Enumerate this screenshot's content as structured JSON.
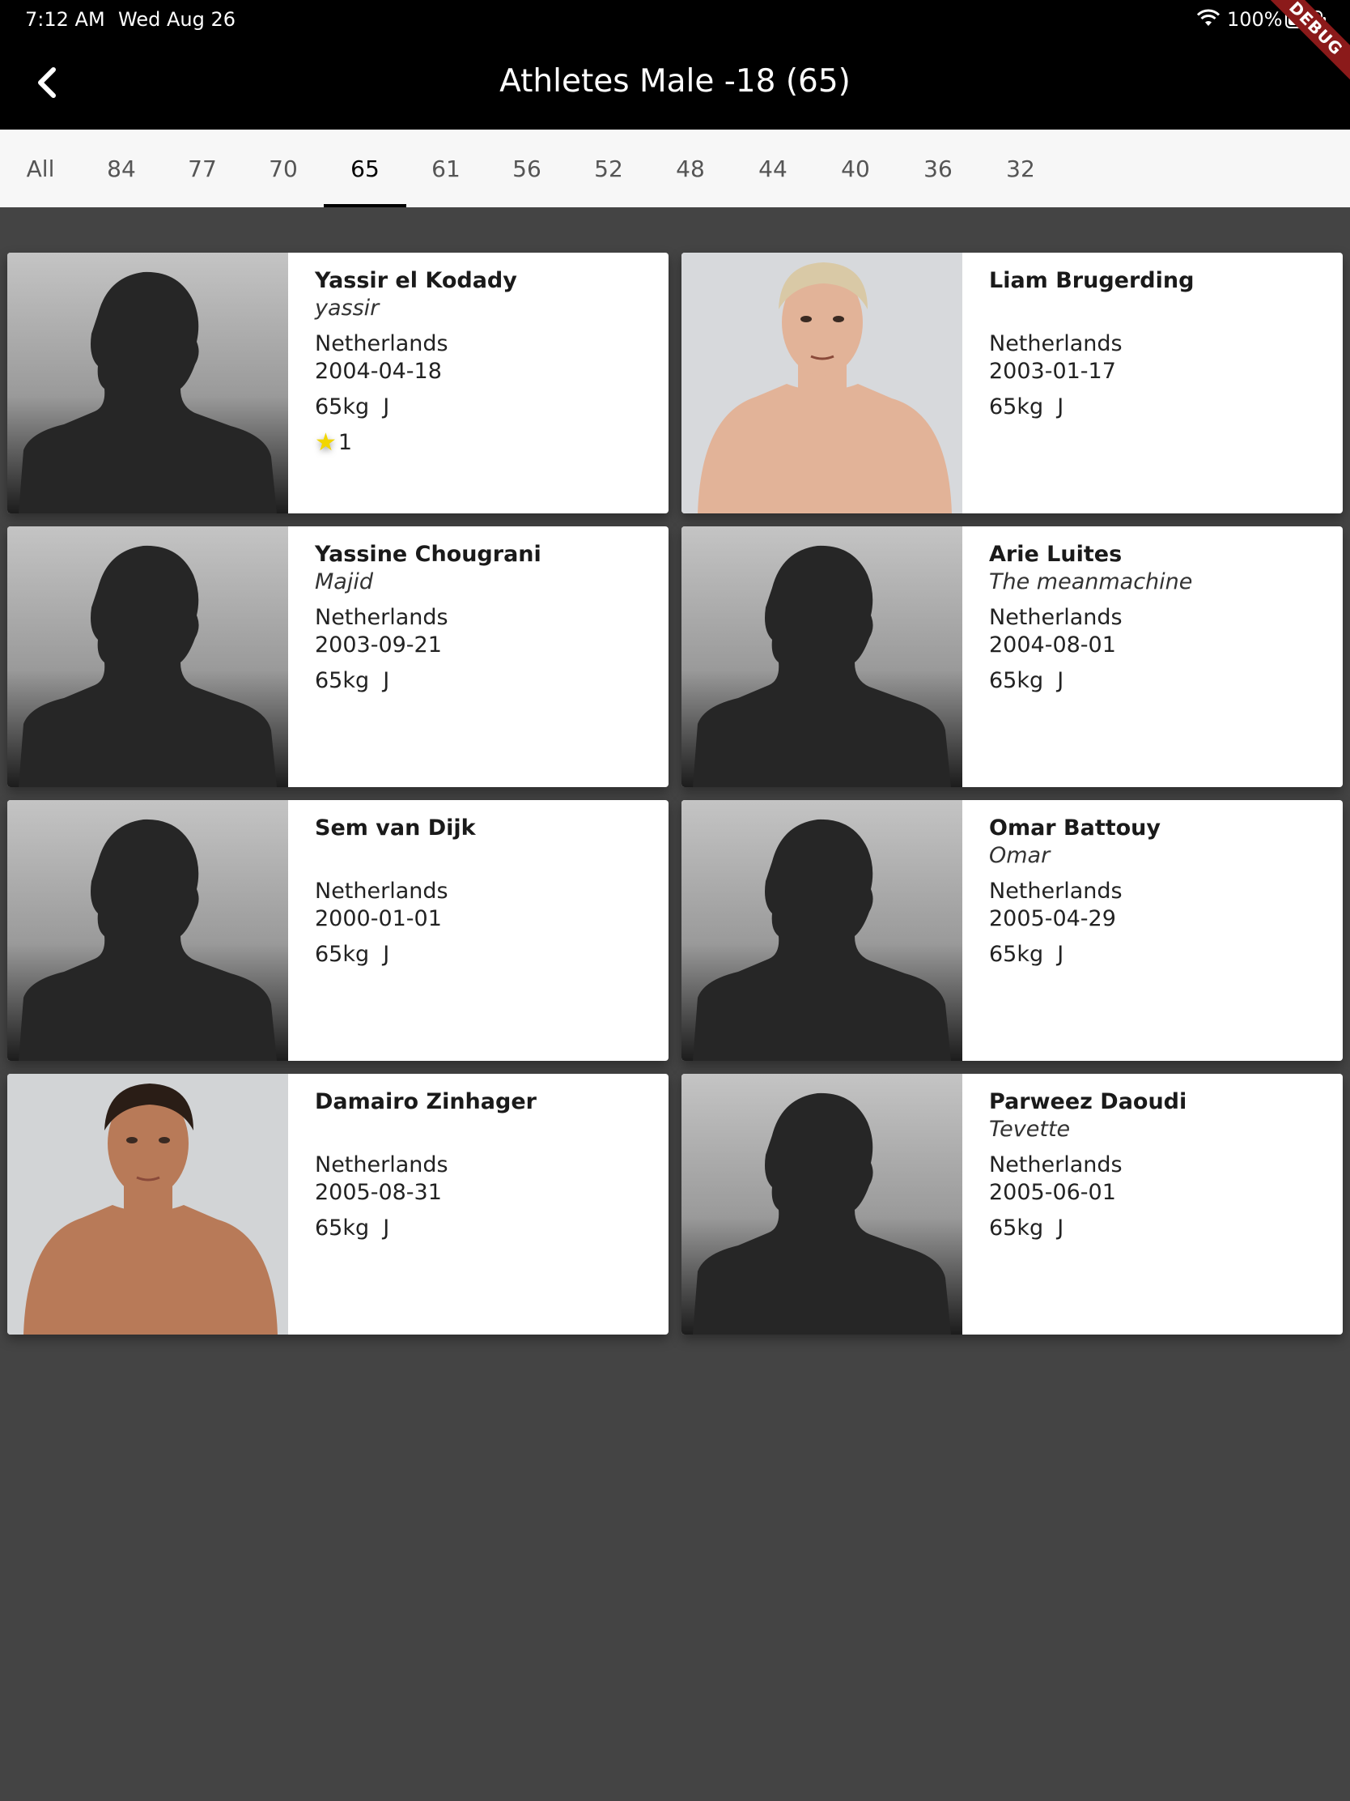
{
  "status": {
    "time": "7:12 AM",
    "date": "Wed Aug 26",
    "battery": "100%"
  },
  "debug_label": "DEBUG",
  "header": {
    "title": "Athletes Male -18 (65)"
  },
  "tabs": [
    {
      "label": "All"
    },
    {
      "label": "84"
    },
    {
      "label": "77"
    },
    {
      "label": "70"
    },
    {
      "label": "65",
      "active": true
    },
    {
      "label": "61"
    },
    {
      "label": "56"
    },
    {
      "label": "52"
    },
    {
      "label": "48"
    },
    {
      "label": "44"
    },
    {
      "label": "40"
    },
    {
      "label": "36"
    },
    {
      "label": "32"
    }
  ],
  "athletes": [
    {
      "name": "Yassir el Kodady",
      "nickname": "yassir",
      "country": "Netherlands",
      "dob": "2004-04-18",
      "weight": "65kg  J",
      "rank": "1",
      "photo": "silhouette"
    },
    {
      "name": "Liam Brugerding",
      "nickname": "",
      "country": "Netherlands",
      "dob": "2003-01-17",
      "weight": "65kg  J",
      "photo": "portrait-light-hair"
    },
    {
      "name": "Yassine Chougrani",
      "nickname": "Majid",
      "country": "Netherlands",
      "dob": "2003-09-21",
      "weight": "65kg  J",
      "photo": "silhouette"
    },
    {
      "name": "Arie Luites",
      "nickname": "The meanmachine",
      "country": "Netherlands",
      "dob": "2004-08-01",
      "weight": "65kg  J",
      "photo": "silhouette"
    },
    {
      "name": "Sem van Dijk",
      "nickname": "",
      "country": "Netherlands",
      "dob": "2000-01-01",
      "weight": "65kg  J",
      "photo": "silhouette"
    },
    {
      "name": "Omar Battouy",
      "nickname": "Omar",
      "country": "Netherlands",
      "dob": "2005-04-29",
      "weight": "65kg  J",
      "photo": "silhouette"
    },
    {
      "name": "Damairo Zinhager",
      "nickname": "",
      "country": "Netherlands",
      "dob": "2005-08-31",
      "weight": "65kg  J",
      "photo": "portrait-dark-hair"
    },
    {
      "name": "Parweez Daoudi",
      "nickname": "Tevette",
      "country": "Netherlands",
      "dob": "2005-06-01",
      "weight": "65kg  J",
      "photo": "silhouette"
    }
  ]
}
